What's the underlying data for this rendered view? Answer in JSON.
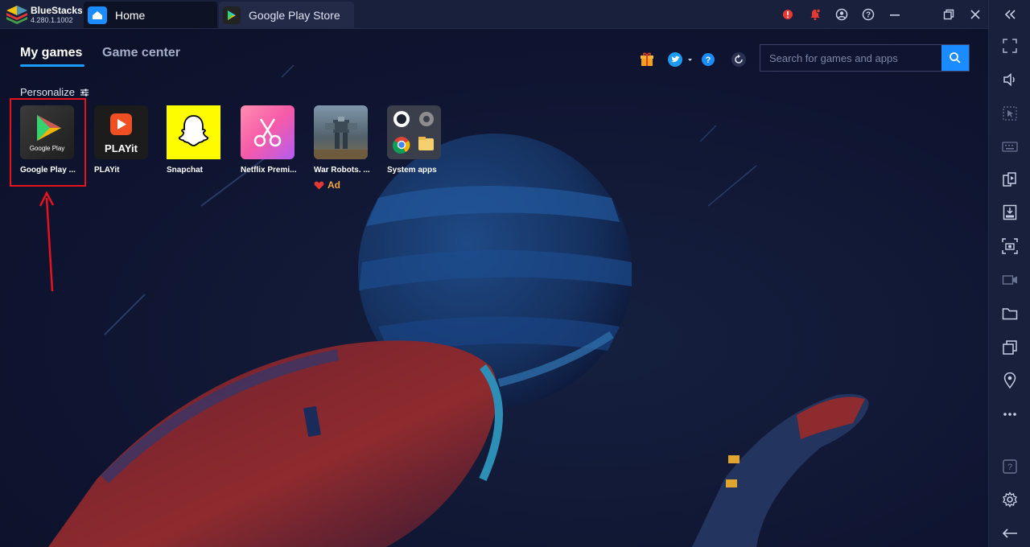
{
  "titlebar": {
    "app_name": "BlueStacks",
    "version": "4.280.1.1002",
    "tabs": [
      {
        "label": "Home"
      },
      {
        "label": "Google Play Store"
      }
    ],
    "icons": [
      "alert-icon",
      "notification-bell-icon",
      "account-icon",
      "help-icon",
      "minimize-icon",
      "restore-icon",
      "close-icon",
      "collapse-sidebar-icon"
    ]
  },
  "main": {
    "tabs": [
      {
        "label": "My games",
        "active": true
      },
      {
        "label": "Game center",
        "active": false
      }
    ],
    "search": {
      "placeholder": "Search for games and apps"
    },
    "personalize_label": "Personalize",
    "apps": [
      {
        "name": "Google Play ...",
        "icon_caption": "Google Play"
      },
      {
        "name": "PLAYit",
        "icon_caption": "PLAYit"
      },
      {
        "name": "Snapchat"
      },
      {
        "name": "Netflix Premi..."
      },
      {
        "name": "War Robots. ...",
        "badge": "Ad"
      },
      {
        "name": "System apps"
      }
    ]
  },
  "colors": {
    "accent": "#1a8cff",
    "highlight": "#e8121c",
    "ad": "#f0a541"
  },
  "sidebar": {
    "icons": [
      "fullscreen-icon",
      "volume-icon",
      "pointer-icon",
      "keyboard-icon",
      "multi-instance-icon",
      "install-apk-icon",
      "screenshot-icon",
      "record-icon",
      "folder-icon",
      "copy-icon",
      "location-icon",
      "more-icon",
      "help-icon",
      "settings-icon",
      "back-icon"
    ]
  }
}
